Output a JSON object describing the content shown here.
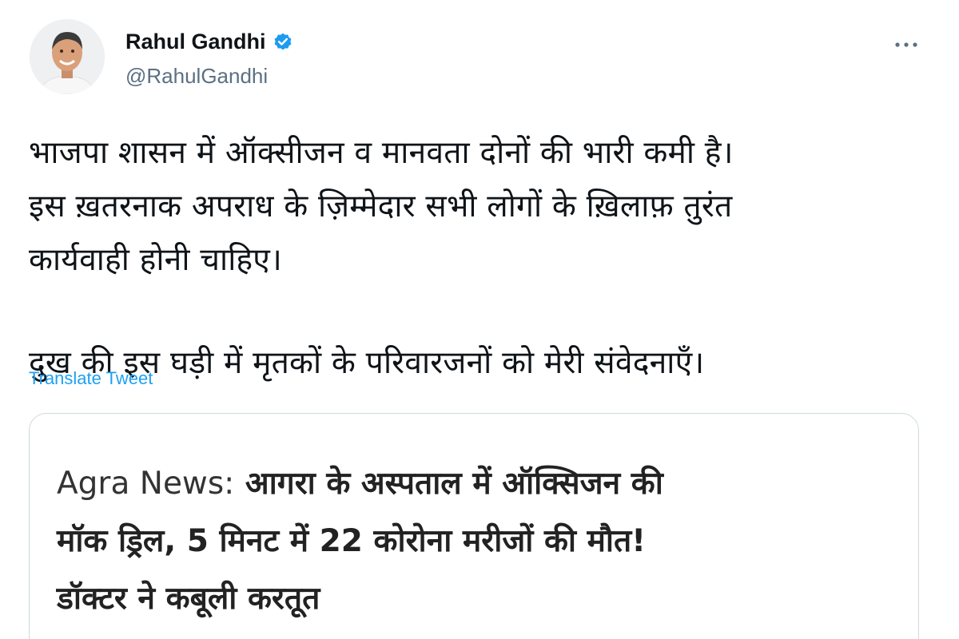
{
  "tweet": {
    "author": {
      "name": "Rahul Gandhi",
      "handle": "@RahulGandhi",
      "verified": true,
      "avatar_icon": "profile-photo"
    },
    "menu_icon": "more-horizontal-icon",
    "text": {
      "para1_line1": "भाजपा शासन में ऑक्सीजन व मानवता दोनों की भारी कमी है।",
      "para1_line2": "इस ख़तरनाक अपराध के ज़िम्मेदार सभी लोगों के ख़िलाफ़ तुरंत",
      "para1_line3": "कार्यवाही होनी चाहिए।",
      "para2": "दुख की इस घड़ी में मृतकों के परिवारजनों को मेरी संवेदनाएँ।"
    },
    "translate_label": "Translate Tweet",
    "card": {
      "headline_prefix": "Agra News:",
      "headline_line1_rest": " आगरा के अस्पताल में ऑक्सिजन की",
      "headline_line2": "मॉक ड्रिल, 5 मिनट में 22 कोरोना मरीजों की मौत!",
      "headline_line3": "डॉक्टर ने कबूली करतूत"
    }
  },
  "colors": {
    "link": "#1da1f2",
    "verified_badge": "#1d9bf0",
    "secondary_text": "#5b7083",
    "border": "#cfd9de"
  }
}
